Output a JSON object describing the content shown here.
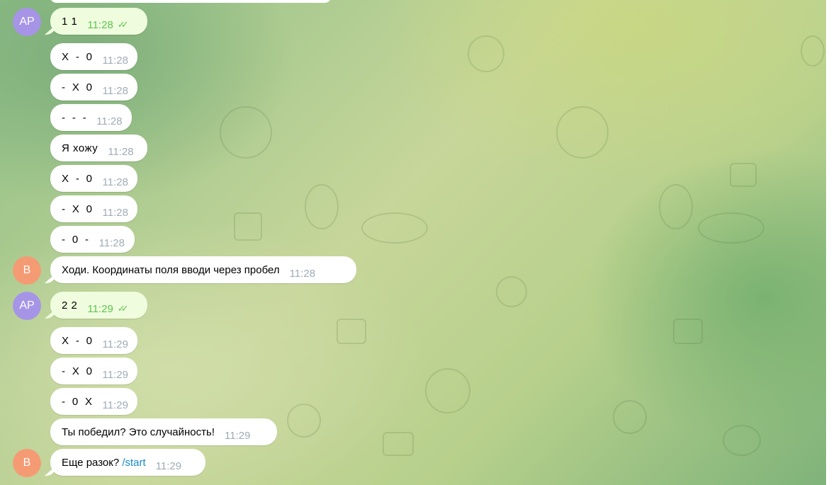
{
  "avatars": {
    "user_initials": "AP",
    "bot_initials": "B",
    "user_color": "#a695e7",
    "bot_color": "#f59b74"
  },
  "colors": {
    "outgoing_bubble": "#effdde",
    "incoming_bubble": "#ffffff",
    "link": "#168acd",
    "read_checks": "#5dc452"
  },
  "messages": [
    {
      "text": "1 1",
      "time": "11:28",
      "outgoing": true
    },
    {
      "text": "X  -  0",
      "time": "11:28",
      "outgoing": false
    },
    {
      "text": "-  X  0",
      "time": "11:28",
      "outgoing": false
    },
    {
      "text": "-  -  -",
      "time": "11:28",
      "outgoing": false
    },
    {
      "text": "Я хожу",
      "time": "11:28",
      "outgoing": false
    },
    {
      "text": "X  -  0",
      "time": "11:28",
      "outgoing": false
    },
    {
      "text": "-  X  0",
      "time": "11:28",
      "outgoing": false
    },
    {
      "text": "-  0  -",
      "time": "11:28",
      "outgoing": false
    },
    {
      "text": "Ходи. Координаты поля вводи через пробел",
      "time": "11:28",
      "outgoing": false
    },
    {
      "text": "2 2",
      "time": "11:29",
      "outgoing": true
    },
    {
      "text": "X  -  0",
      "time": "11:29",
      "outgoing": false
    },
    {
      "text": "-  X  0",
      "time": "11:29",
      "outgoing": false
    },
    {
      "text": "-  0  X",
      "time": "11:29",
      "outgoing": false
    },
    {
      "text": "Ты победил? Это случайность!",
      "time": "11:29",
      "outgoing": false
    },
    {
      "text": "Еще разок?",
      "link": "/start",
      "time": "11:29",
      "outgoing": false
    }
  ],
  "read_status_icon": "double-check-icon"
}
